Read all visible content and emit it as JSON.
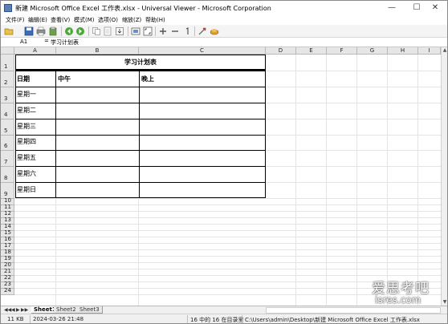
{
  "window": {
    "title": "新建 Microsoft Office Excel 工作表.xlsx - Universal Viewer - Microsoft Corporation",
    "minimize_glyph": "—",
    "maximize_glyph": "☐",
    "close_glyph": "✕"
  },
  "menu": [
    "文件(F)",
    "编辑(E)",
    "查看(V)",
    "模式(M)",
    "选项(O)",
    "缩放(Z)",
    "帮助(H)"
  ],
  "toolbar_icons": [
    "open-icon",
    "save-icon",
    "print-icon",
    "recent-icon",
    "back-icon",
    "forward-icon",
    "copy-icon",
    "copy-page-icon",
    "export-icon",
    "fit-icon",
    "fullscreen-icon",
    "zoom-in-icon",
    "zoom-out-icon",
    "zoom-reset-icon",
    "tools-icon",
    "plugins-icon"
  ],
  "formula_bar": {
    "cell_ref": "A1",
    "equals": "=",
    "value": "学习计划表"
  },
  "columns": [
    "A",
    "B",
    "C",
    "D",
    "E",
    "F",
    "G",
    "H",
    "I"
  ],
  "rows": [
    "1",
    "2",
    "3",
    "4",
    "5",
    "6",
    "7",
    "8",
    "9",
    "10",
    "11",
    "12",
    "13",
    "14",
    "15",
    "16",
    "17",
    "18",
    "19",
    "20",
    "21",
    "22",
    "23",
    "24"
  ],
  "sheet_content": {
    "title": "学习计划表",
    "headers": [
      "日期",
      "中午",
      "晚上"
    ],
    "days": [
      "星期一",
      "星期二",
      "星期三",
      "星期四",
      "星期五",
      "星期六",
      "星期日"
    ]
  },
  "sheet_tabs": [
    "Sheet1",
    "Sheet2",
    "Sheet3"
  ],
  "tab_nav": [
    "◀◀",
    "◀",
    "▶",
    "▶▶"
  ],
  "status": {
    "size": "11 KB",
    "datetime": "2024-03-26 21:48",
    "position": "16 中的 16 在目录里",
    "path": "C:\\Users\\admin\\Desktop\\新建 Microsoft Office Excel 工作表.xlsx"
  },
  "watermark": {
    "title": "爱思考吧",
    "subtitle": "isres.com"
  },
  "colors": {
    "grid": "#e4e4e4",
    "header_bg": "#e6e6e6",
    "table_border": "#000000"
  }
}
